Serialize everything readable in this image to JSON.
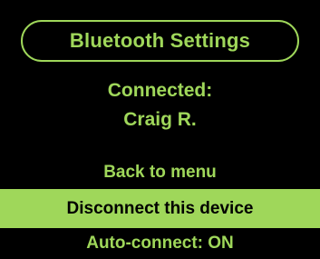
{
  "header": {
    "title": "Bluetooth Settings"
  },
  "status": {
    "label": "Connected:",
    "device_name": "Craig R."
  },
  "menu": {
    "items": [
      {
        "label": "Back to menu",
        "selected": false
      },
      {
        "label": "Disconnect this device",
        "selected": true
      },
      {
        "label": "Auto-connect: ON",
        "selected": false
      }
    ]
  },
  "colors": {
    "accent": "#9fd75a",
    "background": "#000000",
    "selected_text": "#000000"
  }
}
